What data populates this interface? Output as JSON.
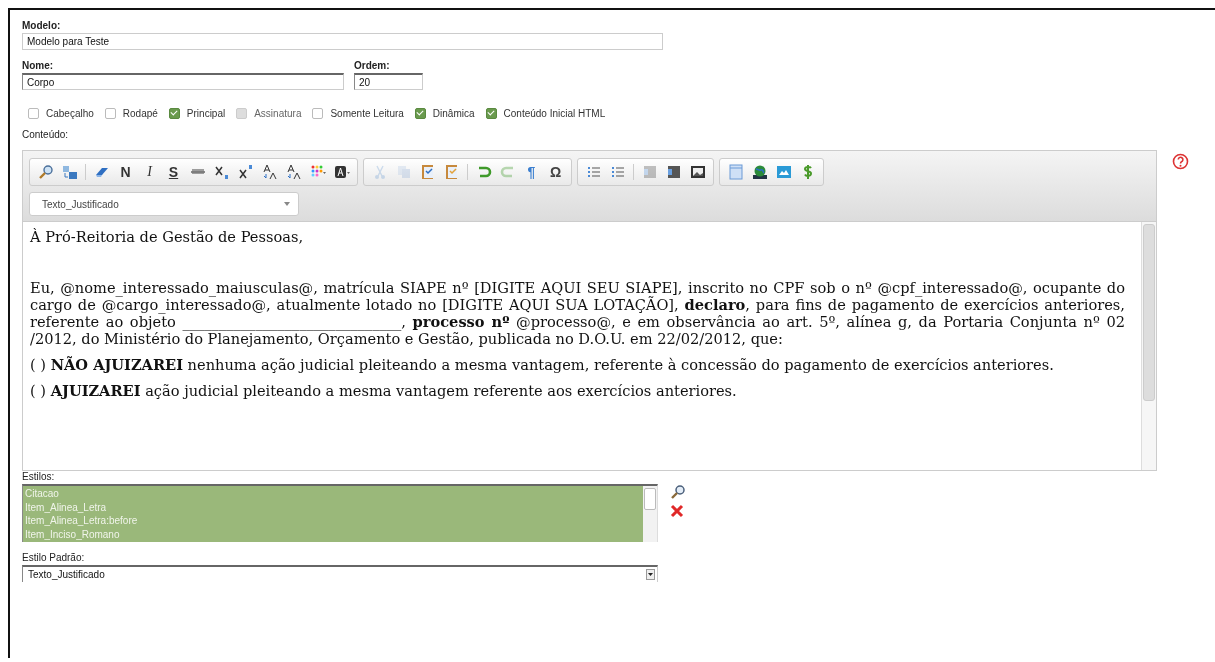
{
  "modelo": {
    "label": "Modelo:",
    "value": "Modelo para Teste"
  },
  "nome": {
    "label": "Nome:",
    "value": "Corpo"
  },
  "ordem": {
    "label": "Ordem:",
    "value": "20"
  },
  "options": [
    {
      "label": "Cabeçalho",
      "checked": false,
      "disabled": false
    },
    {
      "label": "Rodapé",
      "checked": false,
      "disabled": false
    },
    {
      "label": "Principal",
      "checked": true,
      "disabled": false
    },
    {
      "label": "Assinatura",
      "checked": false,
      "disabled": true
    },
    {
      "label": "Somente Leitura",
      "checked": false,
      "disabled": false
    },
    {
      "label": "Dinâmica",
      "checked": true,
      "disabled": false
    },
    {
      "label": "Conteúdo Inicial HTML",
      "checked": true,
      "disabled": false
    }
  ],
  "conteudo_label": "Conteúdo:",
  "toolbar": [
    [
      {
        "kind": "find",
        "disabled": false
      },
      {
        "kind": "replace",
        "disabled": false
      },
      {
        "kind": "sep"
      },
      {
        "kind": "eraser",
        "disabled": false
      },
      {
        "kind": "bold",
        "glyph": "N",
        "disabled": false
      },
      {
        "kind": "italic",
        "glyph": "I",
        "disabled": false
      },
      {
        "kind": "underline",
        "glyph": "S",
        "disabled": false
      },
      {
        "kind": "strike",
        "disabled": false
      },
      {
        "kind": "subscript",
        "disabled": false
      },
      {
        "kind": "superscript",
        "disabled": false
      },
      {
        "kind": "lowercase",
        "disabled": false
      },
      {
        "kind": "uppercase",
        "disabled": false
      },
      {
        "kind": "colors",
        "disabled": false
      },
      {
        "kind": "background",
        "disabled": false
      }
    ],
    [
      {
        "kind": "cut",
        "disabled": true
      },
      {
        "kind": "copy",
        "disabled": true
      },
      {
        "kind": "paste",
        "disabled": false
      },
      {
        "kind": "pasteword",
        "disabled": false
      },
      {
        "kind": "sep"
      },
      {
        "kind": "undo",
        "disabled": false
      },
      {
        "kind": "redo",
        "disabled": true
      },
      {
        "kind": "paragraph",
        "glyph": "¶",
        "disabled": false
      },
      {
        "kind": "symbol",
        "glyph": "Ω",
        "disabled": false
      }
    ],
    [
      {
        "kind": "numbered",
        "disabled": false
      },
      {
        "kind": "bulleted",
        "disabled": false
      },
      {
        "kind": "sep"
      },
      {
        "kind": "outdent",
        "disabled": true
      },
      {
        "kind": "indent",
        "disabled": false
      },
      {
        "kind": "image",
        "disabled": false
      }
    ],
    [
      {
        "kind": "document",
        "disabled": false
      },
      {
        "kind": "globe",
        "disabled": false
      },
      {
        "kind": "picture",
        "disabled": false
      },
      {
        "kind": "dollar",
        "disabled": false
      }
    ]
  ],
  "format_select": "Texto_Justificado",
  "content": [
    {
      "kind": "gap",
      "text": "À Pró-Reitoria de Gestão de Pessoas,"
    },
    {
      "kind": "para",
      "text": "Eu, @nome_interessado_maiusculas@, matrícula SIAPE nº [DIGITE AQUI SEU SIAPE], inscrito no CPF sob o nº @cpf_interessado@, ocupante do cargo de @cargo_interessado@, atualmente lotado no  [DIGITE AQUI SUA LOTAÇÃO], **declaro**, para fins de pagamento de exercícios anteriores, referente ao objeto ______________________________, **processo nº** @processo@, e em observância ao art. 5º, alínea g, da Portaria Conjunta nº 02 /2012, do Ministério do Planejamento, Orçamento e Gestão, publicada no D.O.U. em 22/02/2012, que:"
    },
    {
      "kind": "para",
      "text": "( ) **NÃO AJUIZAREI** nenhuma ação judicial pleiteando a mesma vantagem, referente à concessão do pagamento de exercícios anteriores."
    },
    {
      "kind": "para",
      "text": "( ) **AJUIZAREI** ação judicial pleiteando a mesma vantagem referente aos exercícios anteriores."
    }
  ],
  "estilos": {
    "label": "Estilos:",
    "items": [
      {
        "label": "Citacao",
        "selected": true
      },
      {
        "label": "Item_Alinea_Letra",
        "selected": true
      },
      {
        "label": "Item_Alinea_Letra:before",
        "selected": true
      },
      {
        "label": "Item_Inciso_Romano",
        "selected": true
      }
    ]
  },
  "estilo_padrao": {
    "label": "Estilo Padrão:",
    "value": "Texto_Justificado"
  }
}
